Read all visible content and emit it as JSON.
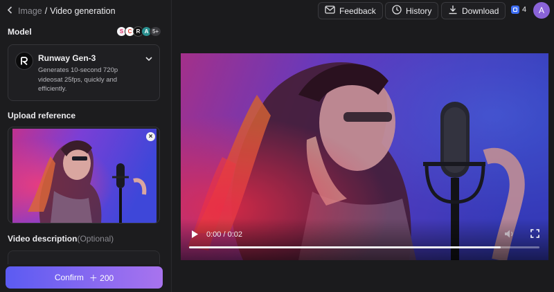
{
  "breadcrumb": {
    "parent": "Image",
    "separator": "/",
    "current": "Video generation"
  },
  "model": {
    "section_label": "Model",
    "provider_badges": [
      "S",
      "C",
      "R",
      "A",
      "5+"
    ],
    "name": "Runway Gen-3",
    "description": "Generates 10-second 720p videosat 25fps, quickly and efficiently."
  },
  "upload": {
    "section_label": "Upload reference",
    "remove_icon": "close-icon"
  },
  "video_description": {
    "label": "Video description",
    "optional": "(Optional)"
  },
  "confirm": {
    "label": "Confirm",
    "cost": "＋ 200"
  },
  "topbar": {
    "feedback": "Feedback",
    "history": "History",
    "download": "Download",
    "credits": "4",
    "user_initial": "A"
  },
  "player": {
    "time": "0:00 / 0:02",
    "progress": 0.89,
    "icons": [
      "play-icon",
      "volume-icon",
      "fullscreen-icon"
    ]
  },
  "colors": {
    "accent_start": "#5b5bf2",
    "accent_end": "#a873ee",
    "background": "#1b1b1d"
  }
}
